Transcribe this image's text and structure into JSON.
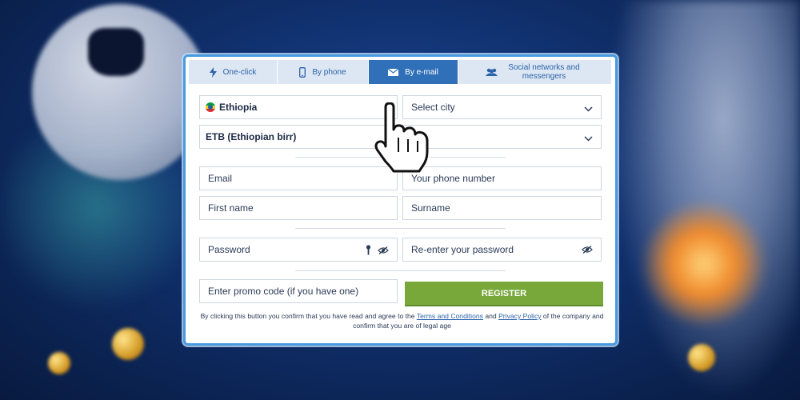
{
  "tabs": [
    {
      "label": "One-click",
      "icon": "lightning-icon"
    },
    {
      "label": "By phone",
      "icon": "phone-icon"
    },
    {
      "label": "By e-mail",
      "icon": "envelope-icon",
      "active": true
    },
    {
      "label": "Social networks and messengers",
      "icon": "people-icon"
    }
  ],
  "form": {
    "country": "Ethiopia",
    "city_placeholder": "Select city",
    "currency": "ETB (Ethiopian birr)",
    "email_placeholder": "Email",
    "phone_placeholder": "Your phone number",
    "first_name_placeholder": "First name",
    "surname_placeholder": "Surname",
    "password_placeholder": "Password",
    "reenter_password_placeholder": "Re-enter your password",
    "promo_placeholder": "Enter promo code (if you have one)",
    "register_label": "REGISTER"
  },
  "legal": {
    "part1": "By clicking this button you confirm that you have read and agree to the ",
    "terms_link": "Terms and Conditions",
    "part2": " and ",
    "privacy_link": "Privacy Policy",
    "part3": " of the company and confirm that you are of legal age"
  },
  "colors": {
    "accent": "#2f70b8",
    "tab_bg": "#dce7f3",
    "register": "#78a83a",
    "border": "#4a9ae0"
  }
}
